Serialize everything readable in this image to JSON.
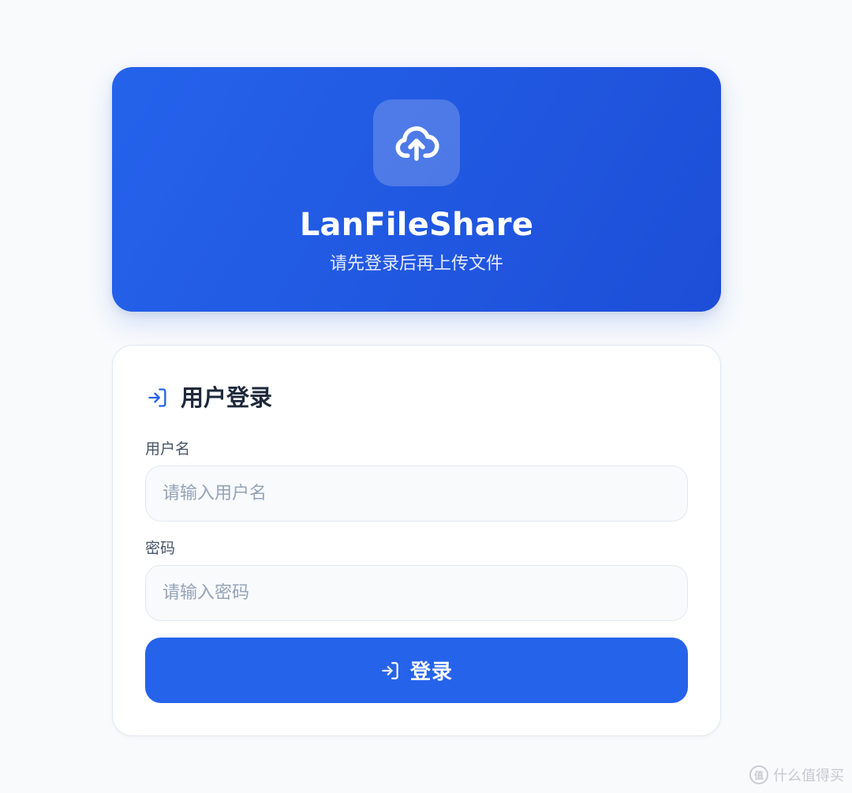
{
  "hero": {
    "icon": "cloud-upload-icon",
    "title": "LanFileShare",
    "subtitle": "请先登录后再上传文件"
  },
  "login": {
    "header_icon": "login-icon",
    "title": "用户登录",
    "username": {
      "label": "用户名",
      "value": "",
      "placeholder": "请输入用户名"
    },
    "password": {
      "label": "密码",
      "value": "",
      "placeholder": "请输入密码"
    },
    "submit_label": "登录"
  },
  "watermark": {
    "text": "什么值得买"
  },
  "colors": {
    "page_background": "#f8fafc",
    "accent": "#2563eb",
    "accent_dark": "#1d4ed8",
    "card_border": "#e2e8f0",
    "title_text": "#1e293b",
    "label_text": "#475569",
    "placeholder_text": "#94a3b8"
  }
}
